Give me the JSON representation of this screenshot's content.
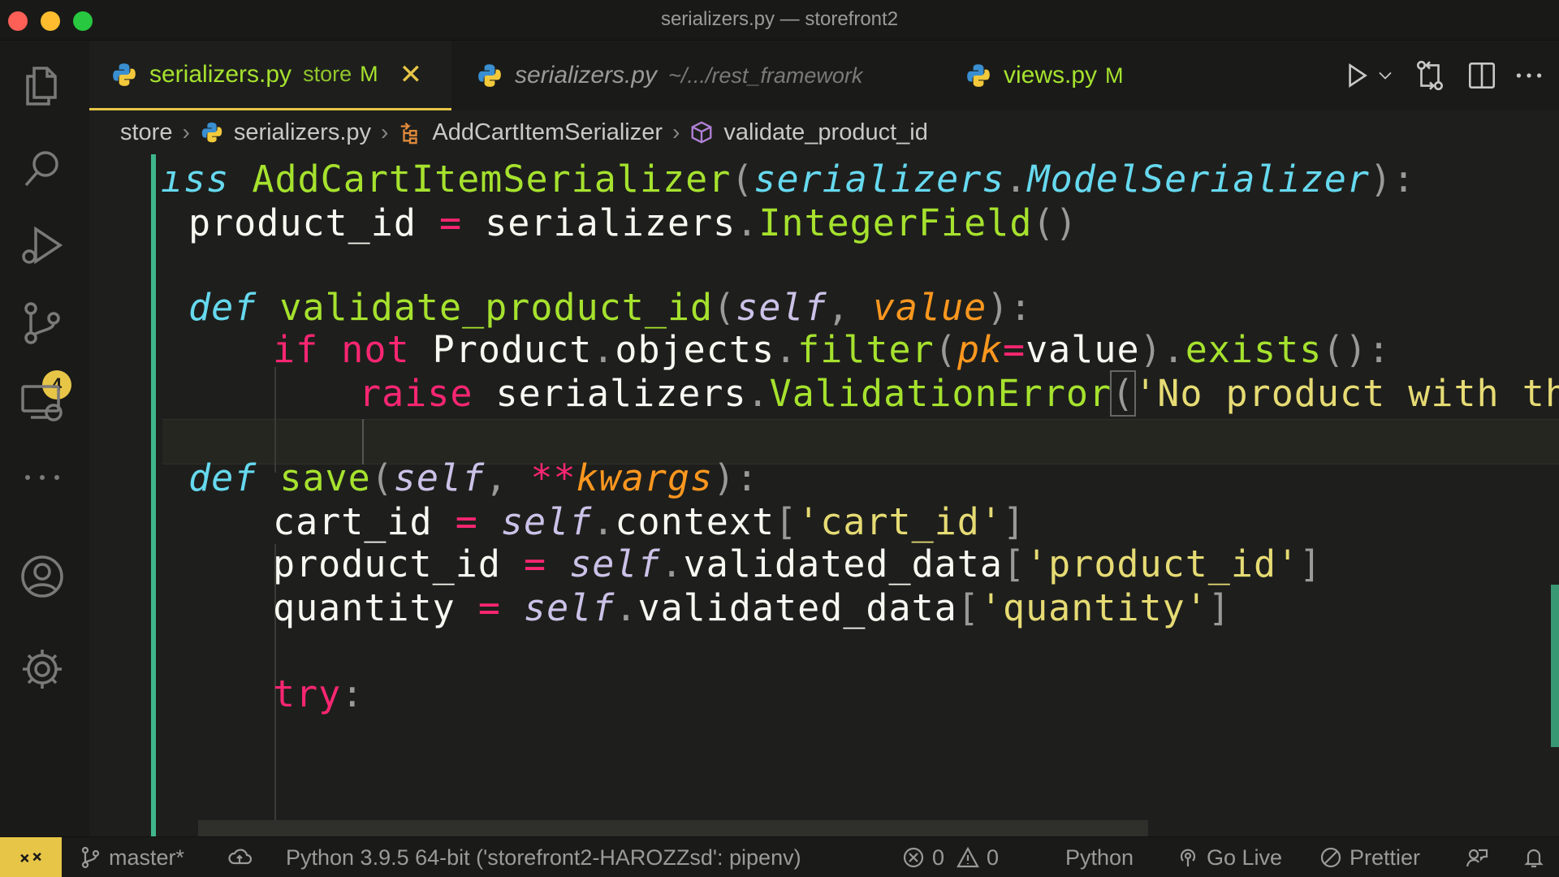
{
  "window": {
    "title": "serializers.py — storefront2"
  },
  "activity_bar": {
    "scm_badge": "4"
  },
  "tabs": [
    {
      "name": "serializers.py",
      "description": "store",
      "status": "M",
      "active": true
    },
    {
      "name": "serializers.py",
      "description": "~/.../rest_framework",
      "active": false
    },
    {
      "name": "views.py",
      "status": "M",
      "active": false
    }
  ],
  "breadcrumb": {
    "folder": "store",
    "file": "serializers.py",
    "class": "AddCartItemSerializer",
    "method": "validate_product_id"
  },
  "code": {
    "l1": {
      "a": "ıss ",
      "b": "AddCartItemSerializer",
      "c": "(",
      "d": "serializers",
      "e": ".",
      "f": "ModelSerializer",
      "g": "):"
    },
    "l2": {
      "a": "product_id ",
      "b": "=",
      "c": " serializers",
      "d": ".",
      "e": "IntegerField",
      "f": "()"
    },
    "l3": {
      "a": "def",
      "b": " validate_product_id",
      "c": "(",
      "d": "self",
      "e": ", ",
      "f": "value",
      "g": "):"
    },
    "l4": {
      "a": "if",
      "b": " not",
      "c": " Product",
      "d": ".",
      "e": "objects",
      "f": ".",
      "g": "filter",
      "h": "(",
      "i": "pk",
      "j": "=",
      "k": "value",
      "l": ")",
      "m": ".",
      "n": "exists",
      "o": "():"
    },
    "l5": {
      "a": "raise",
      "b": " serializers",
      "c": ".",
      "d": "ValidationError",
      "e": "(",
      "f": "'No product with the ",
      "g": "'",
      "h": ")"
    },
    "l6": {
      "a": "def",
      "b": " save",
      "c": "(",
      "d": "self",
      "e": ", ",
      "f": "**",
      "g": "kwargs",
      "h": "):"
    },
    "l7": {
      "a": "cart_id ",
      "b": "=",
      "c": " ",
      "d": "self",
      "e": ".",
      "f": "context",
      "g": "[",
      "h": "'cart_id'",
      "i": "]"
    },
    "l8": {
      "a": "product_id ",
      "b": "=",
      "c": " ",
      "d": "self",
      "e": ".",
      "f": "validated_data",
      "g": "[",
      "h": "'product_id'",
      "i": "]"
    },
    "l9": {
      "a": "quantity ",
      "b": "=",
      "c": " ",
      "d": "self",
      "e": ".",
      "f": "validated_data",
      "g": "[",
      "h": "'quantity'",
      "i": "]"
    },
    "l10": {
      "a": "try",
      "b": ":"
    }
  },
  "status_bar": {
    "branch": "master*",
    "interpreter": "Python 3.9.5 64-bit ('storefront2-HAROZZsd': pipenv)",
    "errors": "0",
    "warnings": "0",
    "language": "Python",
    "go_live": "Go Live",
    "prettier": "Prettier"
  },
  "colors": {
    "accent": "#e7c547",
    "git_modified": "#3fb68b",
    "keyword": "#f92672",
    "function": "#a6e22e",
    "string": "#e6db74"
  },
  "icons": {
    "activity": [
      "files-icon",
      "search-icon",
      "run-debug-icon",
      "source-control-icon",
      "remote-explorer-icon",
      "more-icon",
      "account-icon",
      "settings-gear-icon"
    ],
    "tab_actions": [
      "run-icon",
      "chevron-down-icon",
      "compare-changes-icon",
      "split-editor-icon",
      "more-actions-icon"
    ]
  }
}
